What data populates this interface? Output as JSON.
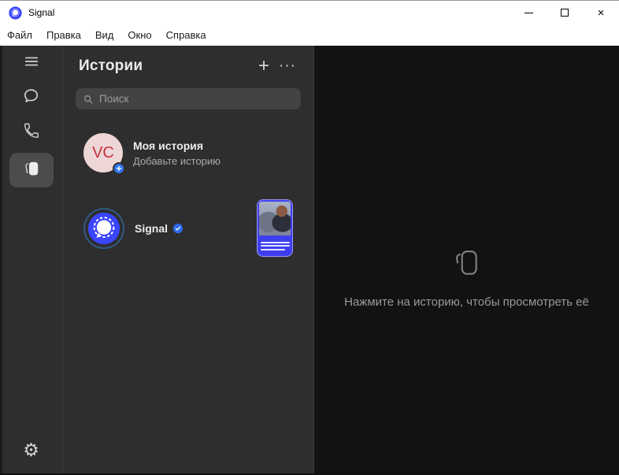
{
  "window": {
    "title": "Signal"
  },
  "titlebar": {
    "icons": {
      "minimize": "minimize-line",
      "maximize": "maximize-box",
      "close_glyph": "×"
    }
  },
  "menubar": {
    "items": [
      "Файл",
      "Правка",
      "Вид",
      "Окно",
      "Справка"
    ]
  },
  "nav": {
    "icons": [
      "hamburger-menu",
      "chat-bubble",
      "phone",
      "stories",
      "settings-gear"
    ],
    "selected": "stories",
    "settings_glyph": "⚙"
  },
  "stories_panel": {
    "title": "Истории",
    "add_story_glyph": "+",
    "more_glyph": "···",
    "search": {
      "placeholder": "Поиск",
      "icon": "magnifier"
    },
    "my_story": {
      "initials": "VC",
      "add_glyph": "+",
      "title": "Моя история",
      "subtitle": "Добавьте историю"
    },
    "rows": [
      {
        "name": "Signal",
        "verified": true,
        "thumbnail": "story-preview-image"
      }
    ]
  },
  "preview_panel": {
    "icon": "stories-outline",
    "hint": "Нажмите на историю, чтобы просмотреть её"
  },
  "colors": {
    "accent": "#3b45fd",
    "verified_badge": "#2c6bed",
    "story_ring": "#2f5b85",
    "avatar_bg": "#eed6d7",
    "avatar_text": "#c5313d",
    "panel_bg": "#2e2e2e",
    "preview_bg": "#121212",
    "selected_nav_bg": "#4c4c4c",
    "search_bg": "#434343",
    "thumb_blue": "#3e3ef0"
  }
}
